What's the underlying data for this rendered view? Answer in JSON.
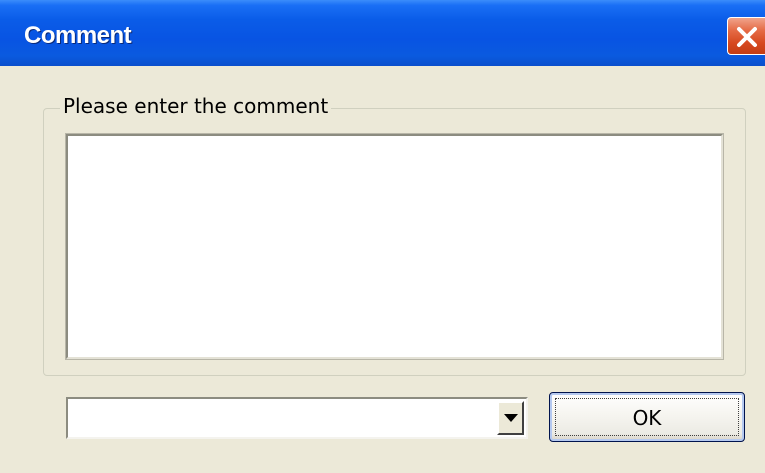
{
  "window": {
    "title": "Comment",
    "close_icon": "close-icon"
  },
  "group": {
    "label": "Please enter the comment"
  },
  "comment": {
    "value": ""
  },
  "combo": {
    "value": "",
    "arrow_icon": "chevron-down-icon"
  },
  "buttons": {
    "ok_label": "OK"
  },
  "colors": {
    "titlebar": "#0854e3",
    "close": "#d6481f",
    "dialog_bg": "#ece9d8"
  }
}
